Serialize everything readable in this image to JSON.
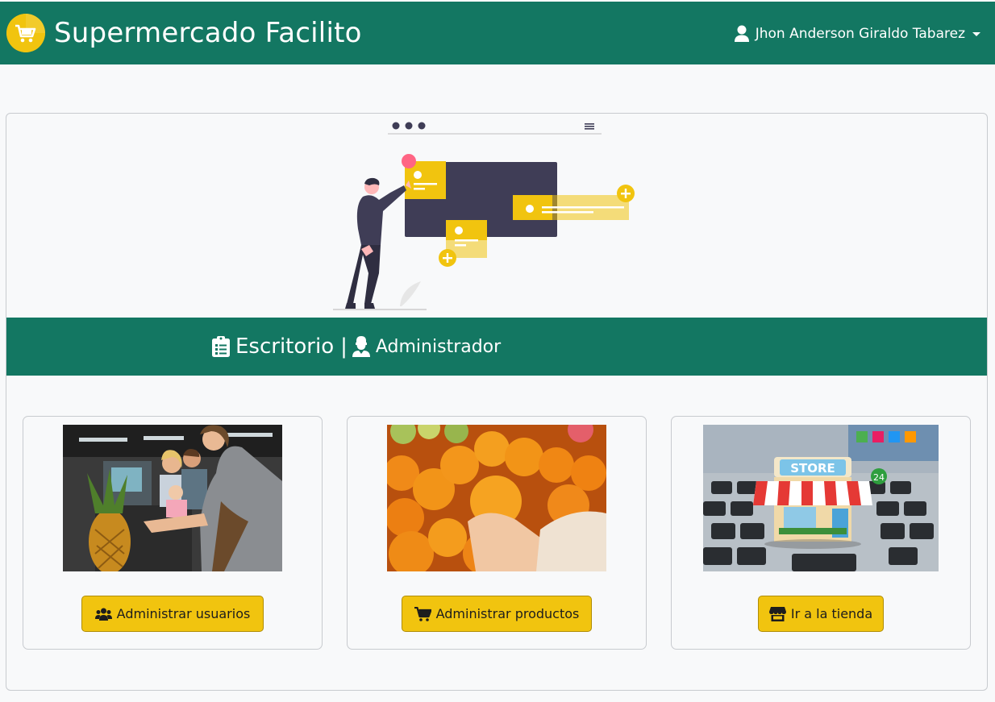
{
  "navbar": {
    "brand_title": "Supermercado Facilito",
    "user_name": "Jhon Anderson Giraldo Tabarez",
    "brand_color": "#137762",
    "accent_color": "#f1c40f"
  },
  "banner": {
    "title": "Escritorio",
    "separator": "|",
    "role": "Administrador"
  },
  "options": [
    {
      "label": "Administrar usuarios",
      "icon": "users-icon"
    },
    {
      "label": "Administrar productos",
      "icon": "cart-icon"
    },
    {
      "label": "Ir a la tienda",
      "icon": "store-icon"
    }
  ],
  "illustration": {
    "icon": "dashboard-illustration"
  },
  "images": {
    "store_sign": "STORE",
    "store_badge": "24"
  }
}
